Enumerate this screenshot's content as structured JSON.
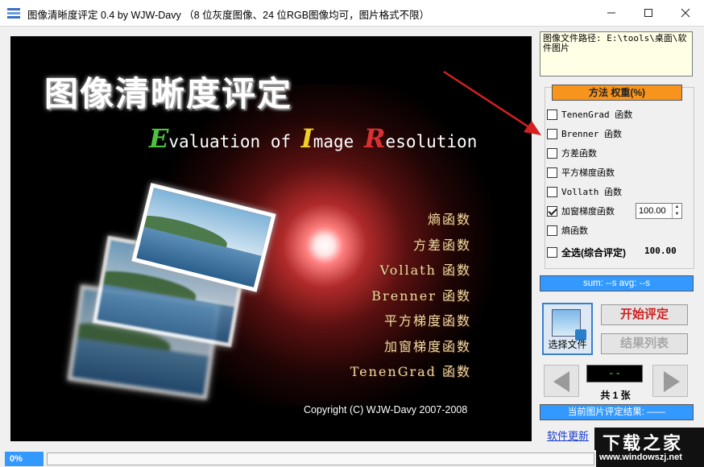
{
  "window": {
    "title": "图像清晰度评定 0.4 by WJW-Davy （8 位灰度图像、24 位RGB图像均可，图片格式不限）",
    "minimize_icon": "minimize-icon",
    "maximize_icon": "maximize-icon",
    "close_icon": "close-icon"
  },
  "splash": {
    "title": "图像清晰度评定",
    "subtitle": {
      "e_cap": "E",
      "e_rest": "valuation of ",
      "i_cap": "I",
      "i_rest": "mage ",
      "r_cap": "R",
      "r_rest": "esolution"
    },
    "functions": [
      "熵函数",
      "方差函数",
      "Vollath 函数",
      "Brenner 函数",
      "平方梯度函数",
      "加窗梯度函数",
      "TenenGrad 函数"
    ],
    "copyright": "Copyright (C) WJW-Davy 2007-2008"
  },
  "path_box": {
    "text": "图像文件路径: E:\\tools\\桌面\\软件图片"
  },
  "methods": {
    "header": "方法  权重(%)",
    "items": [
      {
        "label": "TenenGrad 函数",
        "checked": false
      },
      {
        "label": "Brenner 函数",
        "checked": false
      },
      {
        "label": "方差函数",
        "checked": false
      },
      {
        "label": "平方梯度函数",
        "checked": false
      },
      {
        "label": "Vollath 函数",
        "checked": false
      },
      {
        "label": "加窗梯度函数",
        "checked": true
      },
      {
        "label": "熵函数",
        "checked": false
      }
    ],
    "weight_value": "100.00",
    "select_all_label": "全选(综合评定)",
    "select_all_value": "100.00"
  },
  "stats": {
    "sum_avg": "sum: --s  avg: --s"
  },
  "buttons": {
    "select_file": "选择文件",
    "start": "开始评定",
    "results": "结果列表"
  },
  "navigator": {
    "led": "--",
    "count": "共 1 张"
  },
  "current_result": "当前图片评定结果: ——",
  "update_link": "软件更新",
  "watermark": {
    "title": "下载之家",
    "url": "www.windowszj.net"
  },
  "status": {
    "progress_text": "0%",
    "progress": 0
  },
  "colors": {
    "accent_blue": "#3399ff",
    "method_header": "#f7941d",
    "start_red": "#d02020",
    "led_green": "#35d135"
  }
}
